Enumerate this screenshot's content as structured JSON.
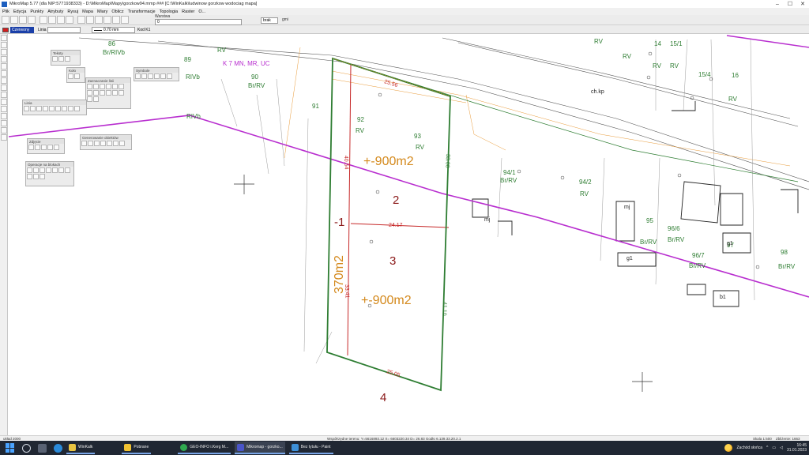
{
  "window": {
    "title": "MikroMap 5.77 (dla NIP:5771938333) - D:\\MikroMap\\Mapy\\gorzkow94.mmp ### [C:\\WinKalk\\ludwinow gorzkow wodociag mapa]",
    "controls": [
      "–",
      "☐",
      "✕"
    ]
  },
  "menu": [
    "Plik",
    "Edycja",
    "Punkty",
    "Atrybuty",
    "Rysuj",
    "Mapa",
    "Miary",
    "Oblicz",
    "Transformacje",
    "Topologia",
    "Raster",
    "O..."
  ],
  "toolbar": {
    "warstwa_label": "Warstwa",
    "warstwa_value": "0",
    "opts_value": "brak",
    "grid_label": "gmi",
    "layer_name": "Czerwony",
    "linia_label": "Linia",
    "line_width": "0.70 mm",
    "kod_label": "Kod",
    "kod_value": "K1"
  },
  "panels": {
    "teksty": "Teksty",
    "kolo": "Koło",
    "linie": "Linia",
    "zaznaczenie": "Zaznaczanie linii",
    "symbole": "Symbole",
    "zdjecie": "Zdjęcie",
    "generowanie": "Generowanie obiektów",
    "operacje": "Operacje na blokach"
  },
  "map": {
    "plots": [
      {
        "label": "1",
        "note": "-1"
      },
      {
        "label": "2"
      },
      {
        "label": "3"
      },
      {
        "label": "4"
      }
    ],
    "area_labels": [
      "+-900m2",
      "+-900m2"
    ],
    "road_width": "370m2",
    "dims": [
      "25.56",
      "40.54",
      "33.00",
      "24.17",
      "33.41",
      "41.10",
      "25.05"
    ],
    "parcels": [
      "86",
      "Br/RIVb",
      "89",
      "RIVb",
      "90",
      "Br/RV",
      "RV",
      "91",
      "RIVb",
      "92",
      "RV",
      "93",
      "RV",
      "94/1",
      "Br/RV",
      "94/2",
      "RV",
      "95",
      "Br/RV",
      "96/6",
      "Br/RV",
      "96/7",
      "Br/RV",
      "97",
      "98",
      "Br/RV",
      "14",
      "RV",
      "15/1",
      "RV",
      "15/4",
      "16",
      "RV",
      "RV",
      "RV"
    ],
    "zoning": "K 7 MN, MR, UC",
    "symbols": [
      "mj",
      "mj",
      "g1",
      "g1",
      "b1",
      "ch.kp"
    ]
  },
  "status": {
    "left": "układ 2000",
    "coords": "Współrzędne terenu: Y=5616893.12  X= 6603220.34  D= 26.83  Godło 6.139.33.20.2.1",
    "scale": "Skala 1:500",
    "zoom": "Zbliżenie: 1663"
  },
  "taskbar": {
    "apps": [
      {
        "name": "WinKalk",
        "color": "#e8c341"
      },
      {
        "name": "Pobrane",
        "color": "#f1c232"
      },
      {
        "name": "GEO-INFO i.Kerg M...",
        "color": "#2fa84f"
      },
      {
        "name": "Mikromap - gorzko...",
        "color": "#4a55c9"
      },
      {
        "name": "Bez tytułu - Paint",
        "color": "#3d8fd6"
      }
    ],
    "weather": "Zachód słońca",
    "time": "16:45",
    "date": "31.01.2023"
  },
  "colors": {
    "plot_boundary": "#2e7d32",
    "division_line": "#c62828",
    "zoning_line": "#b82ecf",
    "area_text": "#d4891c",
    "parcel_text": "#2e7d32"
  }
}
